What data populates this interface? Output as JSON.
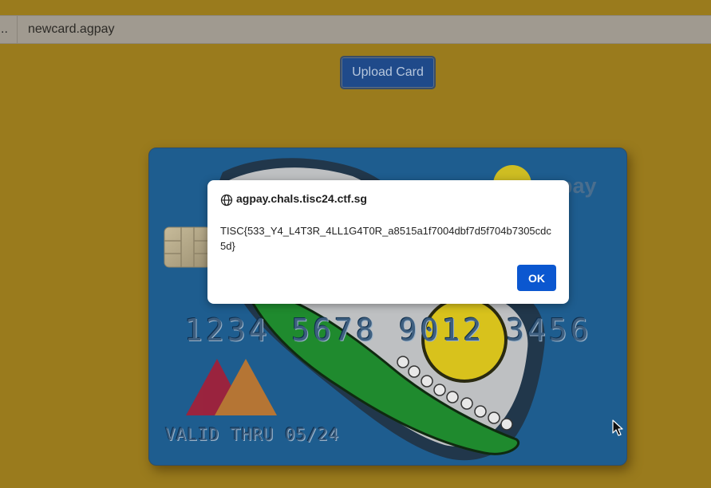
{
  "file_input": {
    "button_label": "..",
    "file_name": "newcard.agpay"
  },
  "upload": {
    "label": "Upload Card"
  },
  "card": {
    "brand": "pay",
    "number": "1234 5678 9012 3456",
    "valid_thru": "VALID THRU 05/24"
  },
  "dialog": {
    "origin": "agpay.chals.tisc24.ctf.sg",
    "message": "TISC{533_Y4_L4T3R_4LL1G4T0R_a8515a1f7004dbf7d5f704b7305cdc5d}",
    "ok_label": "OK"
  },
  "colors": {
    "page_background": "#9a7b1d",
    "card_background": "#1e5d8f",
    "button_blue": "#1f4a8a",
    "ok_blue": "#0b57d0"
  }
}
